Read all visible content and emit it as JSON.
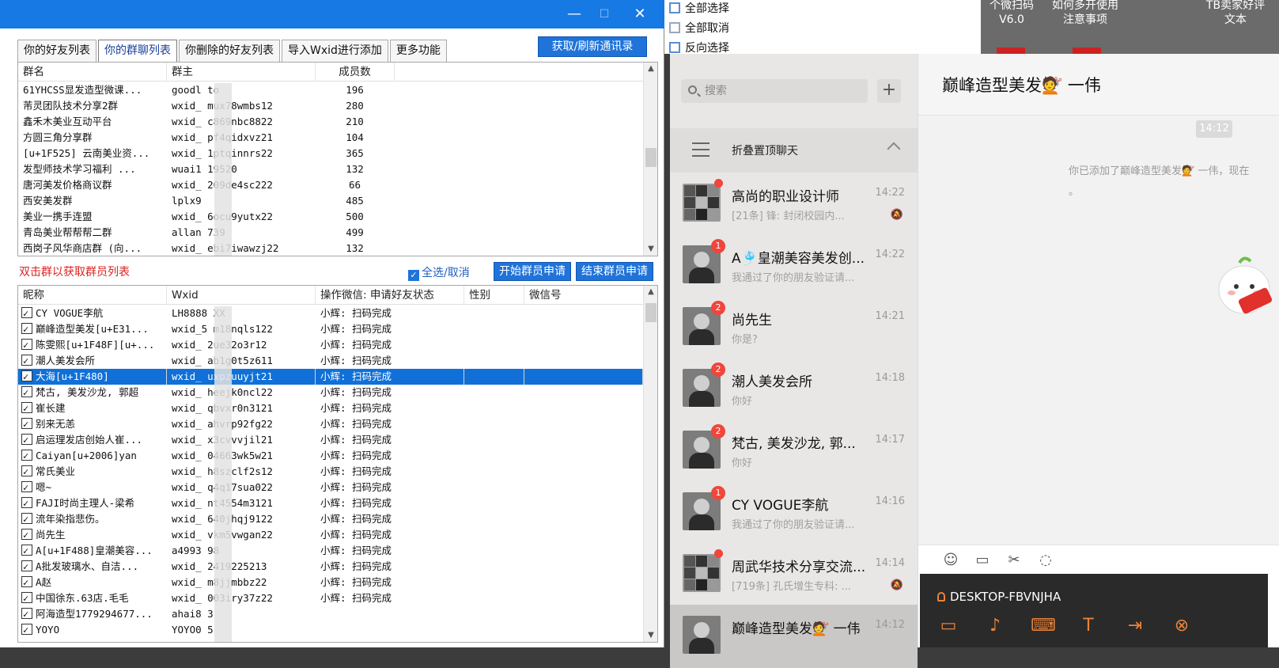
{
  "tool": {
    "tabs": [
      "你的好友列表",
      "你的群聊列表",
      "你删除的好友列表",
      "导入Wxid进行添加",
      "更多功能"
    ],
    "refresh_button": "获取/刷新通讯录",
    "group_columns": [
      "群名",
      "群主",
      "成员数"
    ],
    "groups": [
      [
        "61YHCSS显发造型微课...",
        "goodl    to",
        "196"
      ],
      [
        "芾灵团队技术分享2群",
        "wxid_   mux78wmbs12",
        "280"
      ],
      [
        "鑫禾木美业互动平台",
        "wxid_   c869nbc8822",
        "210"
      ],
      [
        "方圆三角分享群",
        "wxid_   pf4qidxvz21",
        "104"
      ],
      [
        "[u+1F525] 云南美业资...",
        "wxid_   1ptqinnrs22",
        "365"
      ],
      [
        "发型师技术学习福利  ...",
        "wuai1   19520",
        "132"
      ],
      [
        "唐河美发价格商议群",
        "wxid_   209de4sc222",
        "66"
      ],
      [
        "西安美发群",
        "lplx9",
        "485"
      ],
      [
        "美业一携手连盟",
        "wxid_   6ocu9yutx22",
        "500"
      ],
      [
        "青岛美业帮帮帮二群",
        "allan   739",
        "499"
      ],
      [
        "西岗子风华商店群 (向...",
        "wxid_   ebi7iwawzj22",
        "132"
      ]
    ],
    "hint": "双击群以获取群员列表",
    "select_all": "全选/取消",
    "start_button": "开始群员申请",
    "stop_button": "结束群员申请",
    "member_columns": [
      "昵称",
      "Wxid",
      "操作微信: 申请好友状态",
      "性别",
      "微信号"
    ],
    "members": [
      [
        "CY VOGUE李航",
        "LH8888    XX",
        "小辉: 扫码完成"
      ],
      [
        "巅峰造型美发[u+E31...",
        "wxid_5   m18nqls122",
        "小辉: 扫码完成"
      ],
      [
        "陈雯熙[u+1F48F][u+...",
        "wxid_   2ue32o3r12",
        "小辉: 扫码完成"
      ],
      [
        "潮人美发会所",
        "wxid_   ab1g0t5z611",
        "小辉: 扫码完成"
      ],
      [
        "大海[u+1F480]",
        "wxid_   uxpzuuyjt21",
        "小辉: 扫码完成"
      ],
      [
        "梵古, 美发沙龙, 郭超",
        "wxid_   heejk0ncl22",
        "小辉: 扫码完成"
      ],
      [
        "崔长建",
        "wxid_   qbvxr0n3121",
        "小辉: 扫码完成"
      ],
      [
        "别来无恙",
        "wxid_   ahvrp92fg22",
        "小辉: 扫码完成"
      ],
      [
        "启运理发店创始人崔...",
        "wxid_   x3cvvvjil21",
        "小辉: 扫码完成"
      ],
      [
        "Caiyan[u+2006]yan",
        "wxid_   04663wk5w21",
        "小辉: 扫码完成"
      ],
      [
        "常氏美业",
        "wxid_   h8szclf2s12",
        "小辉: 扫码完成"
      ],
      [
        "嗯~",
        "wxid_   q4q17sua022",
        "小辉: 扫码完成"
      ],
      [
        "FAJI时尚主理人-梁希",
        "wxid_   nt4554m3121",
        "小辉: 扫码完成"
      ],
      [
        "流年染指悲伤。",
        "wxid_   640jhqj9122",
        "小辉: 扫码完成"
      ],
      [
        "尚先生",
        "wxid_   vkm5vwgan22",
        "小辉: 扫码完成"
      ],
      [
        "A[u+1F488]皇潮美容...",
        "a4993   98",
        "小辉: 扫码完成"
      ],
      [
        "A批发玻璃水、自洁...",
        "wxid_   2419225213",
        "小辉: 扫码完成"
      ],
      [
        "A赵",
        "wxid_   m8jjmbbz22",
        "小辉: 扫码完成"
      ],
      [
        "中国徐东.63店.毛毛",
        "wxid_   003iry37z22",
        "小辉: 扫码完成"
      ],
      [
        "阿海造型1779294677...",
        "ahai8   3",
        ""
      ],
      [
        "YOYO",
        "YOYO0   5",
        ""
      ]
    ],
    "selected_member_index": 4
  },
  "topstrip": {
    "menu": [
      "全部选择",
      "全部取消",
      "反向选择"
    ],
    "desktop_labels": [
      "个微扫码\nV6.0",
      "如何多开使用\n注意事项",
      "TB卖家好评\n文本"
    ]
  },
  "wechat": {
    "search_placeholder": "搜索",
    "plus": "+",
    "folded_label": "折叠置顶聊天",
    "chats": [
      {
        "name": "高尚的职业设计师",
        "time": "14:22",
        "msg": "[21条] 锋: 封闭校园内...",
        "badge": "",
        "dot": true,
        "muted": true,
        "group": true
      },
      {
        "name": "A🎐皇潮美容美发创...",
        "time": "14:22",
        "msg": "我通过了你的朋友验证请...",
        "badge": "1",
        "dot": false,
        "muted": false,
        "group": false
      },
      {
        "name": "尚先生",
        "time": "14:21",
        "msg": "你是?",
        "badge": "2",
        "dot": false,
        "muted": false,
        "group": false
      },
      {
        "name": "潮人美发会所",
        "time": "14:18",
        "msg": "你好",
        "badge": "2",
        "dot": false,
        "muted": false,
        "group": false
      },
      {
        "name": "梵古, 美发沙龙, 郭...",
        "time": "14:17",
        "msg": "你好",
        "badge": "2",
        "dot": false,
        "muted": false,
        "group": false
      },
      {
        "name": "CY VOGUE李航",
        "time": "14:16",
        "msg": "我通过了你的朋友验证请...",
        "badge": "1",
        "dot": false,
        "muted": false,
        "group": false
      },
      {
        "name": "周武华技术分享交流...",
        "time": "14:14",
        "msg": "[719条] 孔氏增生专科: ...",
        "badge": "",
        "dot": true,
        "muted": true,
        "group": true
      },
      {
        "name": "巅峰造型美发💇 一伟",
        "time": "14:12",
        "msg": "",
        "badge": "",
        "dot": false,
        "muted": false,
        "group": false
      }
    ],
    "chat_title": "巅峰造型美发💇 一伟",
    "time_chip": "14:12",
    "system_msg": "你已添加了巅峰造型美发💇 一伟，现在",
    "system_msg_tail": "。",
    "remote_user": "DESKTOP-FBVNJHA"
  }
}
